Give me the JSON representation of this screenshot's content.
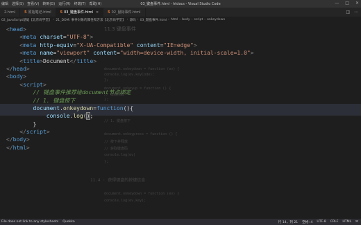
{
  "menu": {
    "items": [
      "编辑",
      "选择(S)",
      "查看(V)",
      "转到(G)",
      "运行(R)",
      "终端(T)",
      "帮助(H)"
    ]
  },
  "window": {
    "title": "03_键盘事件.html - htdocs - Visual Studio Code"
  },
  "tabs": [
    {
      "label": "2.html",
      "active": false,
      "html_icon": false
    },
    {
      "label": "原始笔记.html",
      "active": false,
      "html_icon": true
    },
    {
      "label": "03_键盘事件.html",
      "active": true,
      "html_icon": true
    },
    {
      "label": "02_鼠标事件.html",
      "active": false,
      "html_icon": true
    }
  ],
  "breadcrumb": [
    "02_JavaScript基础【北京尚学堂】",
    "21_DOM: 事件对象的属性和方法【北京尚学堂】",
    "源码",
    "03_键盘事件.html",
    "html",
    "body",
    "script",
    "onkeydown"
  ],
  "code": {
    "lines": [
      {
        "id": "l1"
      },
      {
        "id": "l2"
      },
      {
        "id": "l3"
      },
      {
        "id": "l4"
      },
      {
        "id": "l5"
      }
    ],
    "head_open": "<head>",
    "meta_charset": "UTF-8",
    "meta_http_equiv": "X-UA-Compatible",
    "meta_ie_content": "IE=edge",
    "meta_viewport_name": "viewport",
    "meta_viewport_content": "width=device-width, initial-scale=1.0",
    "title_text": "Document",
    "comment1": "// 键盘事件推荐给document节点绑定",
    "comment2": "// 1. 键盘按下",
    "onkeydown_obj": "document",
    "onkeydown_prop": "onkeydown",
    "function_kw": "function",
    "console_obj": "console",
    "log_fn": "log"
  },
  "overlay": {
    "heading": "11.3 键盘事件",
    "lines": [
      "document.onkeydown = function (ev) {",
      "  console.log(ev.keyCode);",
      "};",
      "document.onkeyup = function () {",
      "  // 键盘抬起",
      "};",
      "// 1. 键盘按下",
      "document.onkeypress = function () {",
      "  // 按下并释放",
      "  // 获取键盘码",
      "  console.log(ev)",
      "};",
      "11.4 · 获得键盘的按键信息",
      "document.onkeydown = function (ev) {",
      "  console.log(ev.key);"
    ]
  },
  "status": {
    "left": [
      "File does not link to any stylesheets",
      "Quokka"
    ],
    "right": [
      "行 14，列 21",
      "空格: 4",
      "UTF-8",
      "CRLF",
      "HTML"
    ]
  },
  "colors": {
    "editor_bg": "#1e1e1e",
    "tag": "#569cd6",
    "attr": "#9cdcfe",
    "string": "#ce9178",
    "comment": "#6a9955",
    "function": "#dcdcaa"
  }
}
